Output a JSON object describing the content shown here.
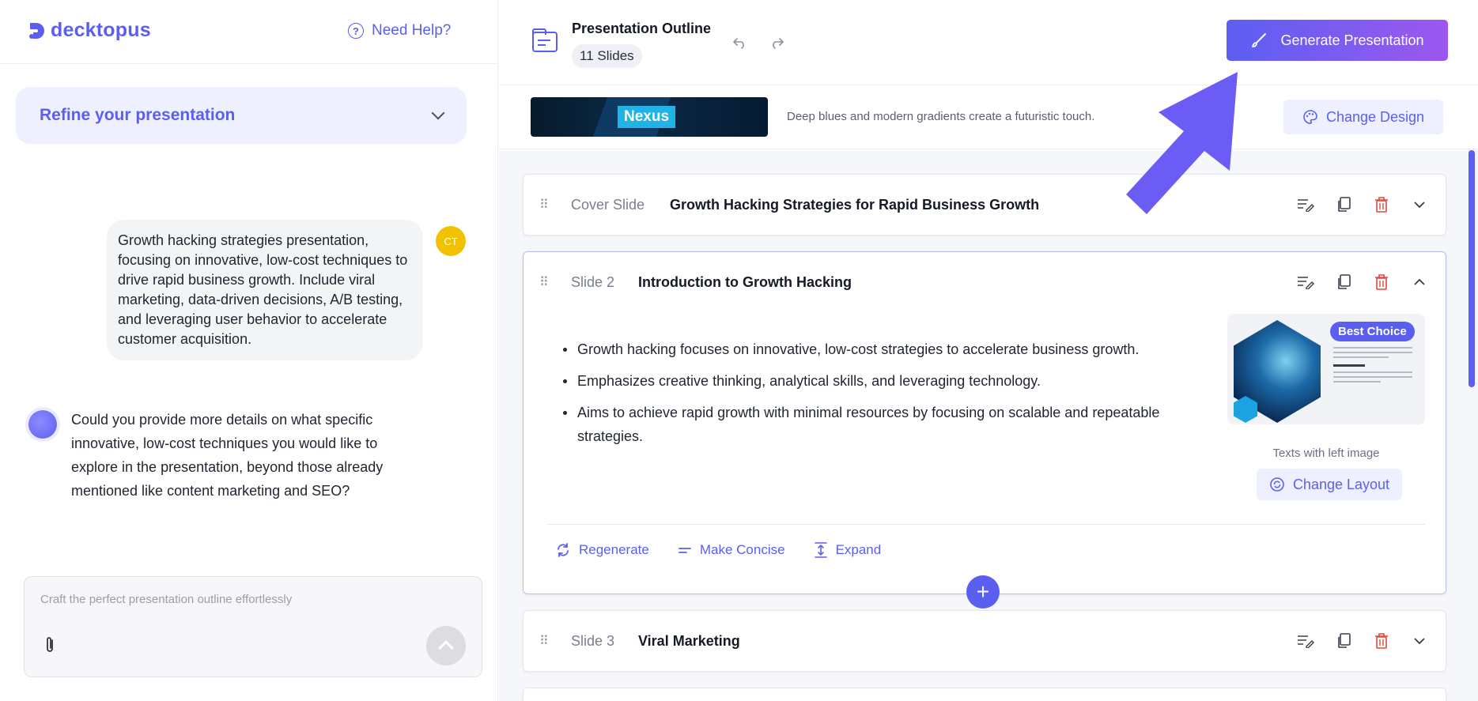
{
  "brand": {
    "name": "decktopus",
    "accent": "#5a5ff0"
  },
  "help": {
    "label": "Need Help?",
    "icon": "question-circle-icon"
  },
  "refine": {
    "label": "Refine your presentation"
  },
  "chat": {
    "user_initials": "CT",
    "user_message": "Growth hacking strategies presentation, focusing on innovative, low-cost techniques to drive rapid business growth. Include viral marketing, data-driven decisions, A/B testing, and leveraging user behavior to accelerate customer acquisition.",
    "bot_message": "Could you provide more details on what specific innovative, low-cost techniques you would like to explore in the presentation, beyond those already mentioned like content marketing and SEO?"
  },
  "composer": {
    "placeholder": "Craft the perfect presentation outline effortlessly"
  },
  "header": {
    "title": "Presentation Outline",
    "slide_count": "11 Slides",
    "generate_label": "Generate Presentation"
  },
  "design": {
    "theme_name": "Nexus",
    "description": "Deep blues and modern gradients create a futuristic touch.",
    "change_label": "Change Design"
  },
  "slides": [
    {
      "number_label": "Cover Slide",
      "title": "Growth Hacking Strategies for Rapid Business Growth"
    },
    {
      "number_label": "Slide 2",
      "title": "Introduction to Growth Hacking",
      "bullets": [
        "Growth hacking focuses on innovative, low-cost strategies to accelerate business growth.",
        "Emphasizes creative thinking, analytical skills, and leveraging technology.",
        "Aims to achieve rapid growth with minimal resources by focusing on scalable and repeatable strategies."
      ],
      "layout_badge": "Best Choice",
      "layout_name": "Texts with left image",
      "change_layout_label": "Change Layout",
      "tools": {
        "regenerate": "Regenerate",
        "concise": "Make Concise",
        "expand": "Expand"
      }
    },
    {
      "number_label": "Slide 3",
      "title": "Viral Marketing"
    }
  ],
  "colors": {
    "danger": "#e0483f",
    "gradient_start": "#5b5ff1",
    "gradient_end": "#9c58f0",
    "avatar": "#f2c200"
  }
}
